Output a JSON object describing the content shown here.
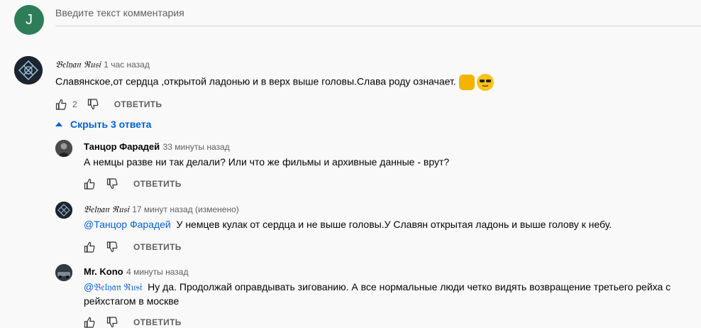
{
  "composer": {
    "avatar_letter": "J",
    "placeholder": "Введите текст комментария"
  },
  "comment": {
    "author": "𝔅𝔢𝔩𝔶𝔞𝔫 ℜ𝔲𝔰𝔦",
    "time": "1 час назад",
    "text": "Славянское,от сердца ,открытой ладонью и в верх выше головы.Слава роду означает.",
    "emojis": [
      "flexed-biceps",
      "smiling-face-with-sunglasses"
    ],
    "likes": "2",
    "reply_label": "ОТВЕТИТЬ"
  },
  "toggle_replies": "Скрыть 3 ответа",
  "replies": [
    {
      "author": "Танцор Фарадей",
      "time": "33 минуты назад",
      "mention": "",
      "text": "А немцы разве ни так делали? Или что же фильмы и архивные данные - врут?",
      "reply_label": "ОТВЕТИТЬ"
    },
    {
      "author": "𝔅𝔢𝔩𝔶𝔞𝔫 ℜ𝔲𝔰𝔦",
      "time": "17 минут назад (изменено)",
      "mention": "@Танцор Фарадей",
      "text": "У немцев кулак от сердца и не выше головы.У Славян открытая ладонь и выше голову к небу.",
      "reply_label": "ОТВЕТИТЬ"
    },
    {
      "author": "Mr. Kono",
      "time": "4 минуты назад",
      "mention": "@𝔅𝔢𝔩𝔶𝔞𝔫 ℜ𝔲𝔰𝔦",
      "text_line1": "Ну да. Продолжай оправдывать зигованию. А все нормальные люди четко видять возвращение третьего рейха с",
      "text_line2": "рейхстагом в москве",
      "reply_label": "ОТВЕТИТЬ"
    }
  ],
  "colors": {
    "accent": "#065fd4",
    "avatar_j": "#2e7d59",
    "background": "#f9f9f9"
  }
}
